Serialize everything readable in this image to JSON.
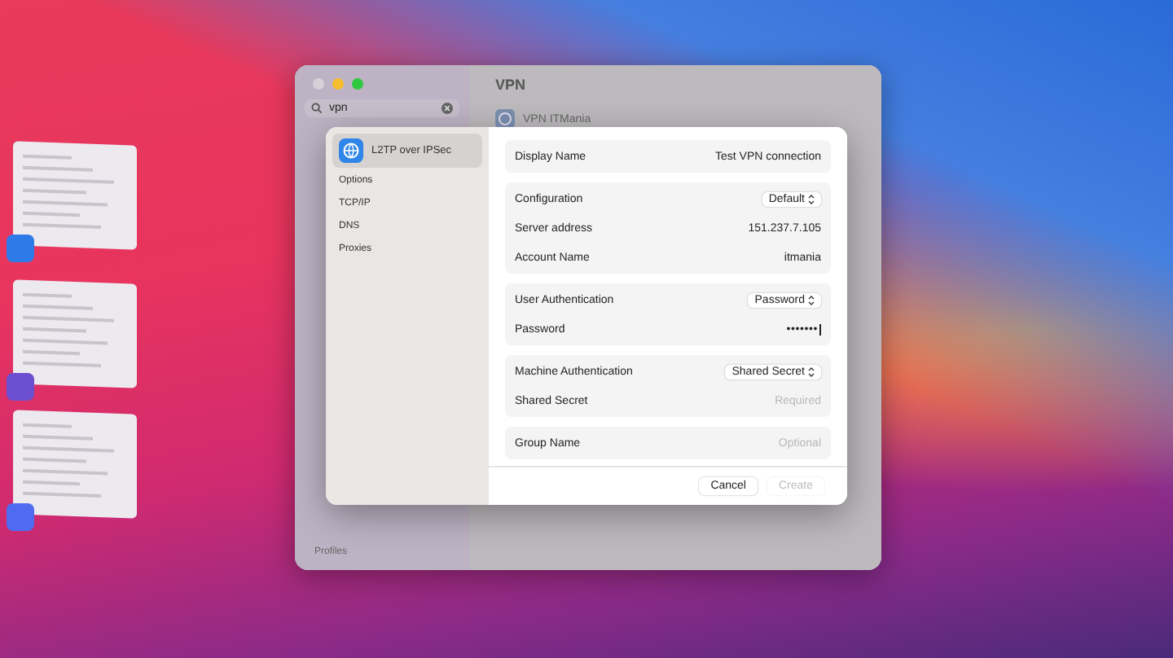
{
  "window": {
    "title": "VPN",
    "search": {
      "value": "vpn"
    },
    "service": {
      "label": "VPN ITMania"
    },
    "footer_label": "Profiles"
  },
  "sheet": {
    "sidebar": [
      {
        "label": "L2TP over IPSec",
        "selected": true,
        "kind": "service"
      },
      {
        "label": "Options",
        "selected": false,
        "kind": "tab"
      },
      {
        "label": "TCP/IP",
        "selected": false,
        "kind": "tab"
      },
      {
        "label": "DNS",
        "selected": false,
        "kind": "tab"
      },
      {
        "label": "Proxies",
        "selected": false,
        "kind": "tab"
      }
    ],
    "groups": [
      [
        {
          "label": "Display Name",
          "kind": "text",
          "value": "Test VPN connection"
        }
      ],
      [
        {
          "label": "Configuration",
          "kind": "popup",
          "value": "Default"
        },
        {
          "label": "Server address",
          "kind": "text",
          "value": "151.237.7.105"
        },
        {
          "label": "Account Name",
          "kind": "text",
          "value": "itmania"
        }
      ],
      [
        {
          "label": "User Authentication",
          "kind": "popup",
          "value": "Password"
        },
        {
          "label": "Password",
          "kind": "password",
          "value": "•••••••"
        }
      ],
      [
        {
          "label": "Machine Authentication",
          "kind": "popup",
          "value": "Shared Secret"
        },
        {
          "label": "Shared Secret",
          "kind": "empty",
          "placeholder": "Required"
        }
      ],
      [
        {
          "label": "Group Name",
          "kind": "empty",
          "placeholder": "Optional"
        }
      ]
    ],
    "buttons": [
      {
        "label": "Cancel",
        "disabled": false
      },
      {
        "label": "Create",
        "disabled": true
      }
    ]
  }
}
